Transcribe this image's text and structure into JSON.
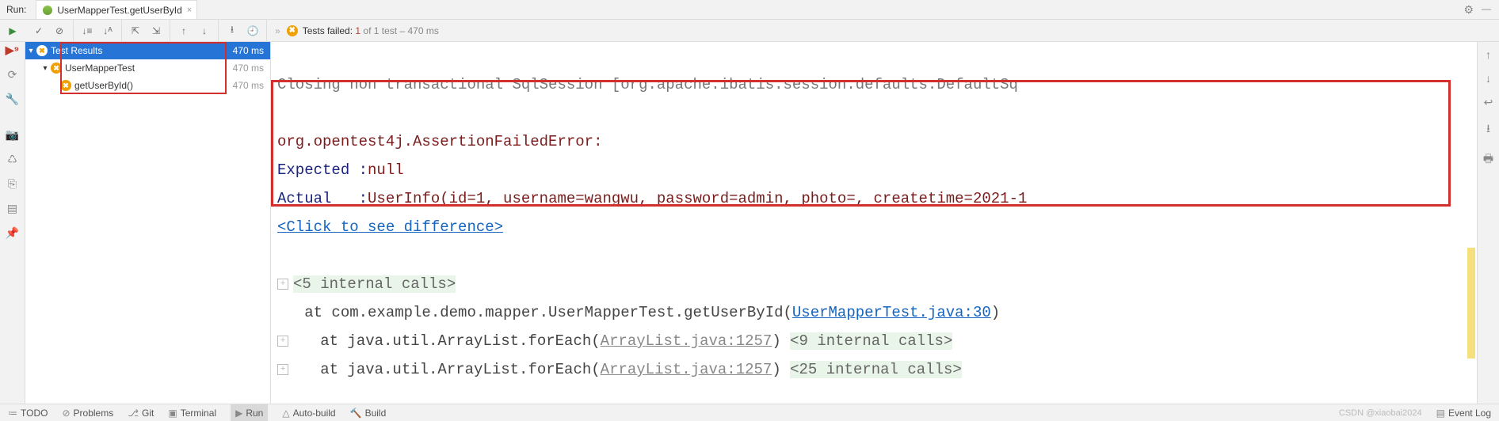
{
  "top": {
    "run_label": "Run:",
    "tab_title": "UserMapperTest.getUserById",
    "tab_close": "×",
    "gear": "⚙",
    "minimize": "—"
  },
  "status": {
    "arrows": "»",
    "prefix": "Tests failed:",
    "fail_count": "1",
    "of_text": " of 1 test",
    "duration": " – 470 ms"
  },
  "tree": {
    "root": {
      "label": "Test Results",
      "time": "470 ms"
    },
    "class": {
      "label": "UserMapperTest",
      "time": "470 ms"
    },
    "method": {
      "label": "getUserById()",
      "time": "470 ms"
    }
  },
  "console": {
    "cut": "Closing non transactional SqlSession [org.apache.ibatis.session.defaults.DefaultSq",
    "err1": "org.opentest4j.AssertionFailedError:",
    "exp_label": "Expected :",
    "exp_val": "null",
    "act_label": "Actual   :",
    "act_val": "UserInfo(id=1, username=wangwu, password=admin, photo=, createtime=2021-1",
    "diff": "<Click to see difference>",
    "ic5": "<5 internal calls>",
    "at1_pre": "   at com.example.demo.mapper.UserMapperTest.getUserById(",
    "at1_link": "UserMapperTest.java:30",
    "at1_post": ")",
    "at2_pre": "   at java.util.ArrayList.forEach(",
    "at2_link": "ArrayList.java:1257",
    "at2_post": ") ",
    "ic9": "<9 internal calls>",
    "at3_pre": "   at java.util.ArrayList.forEach(",
    "at3_link": "ArrayList.java:1257",
    "at3_post": ") ",
    "ic25": "<25 internal calls>"
  },
  "bottom": {
    "todo": "TODO",
    "problems": "Problems",
    "git": "Git",
    "terminal": "Terminal",
    "run": "Run",
    "autobuild": "Auto-build",
    "build": "Build",
    "eventlog": "Event Log",
    "watermark": "CSDN @xiaobai2024"
  }
}
